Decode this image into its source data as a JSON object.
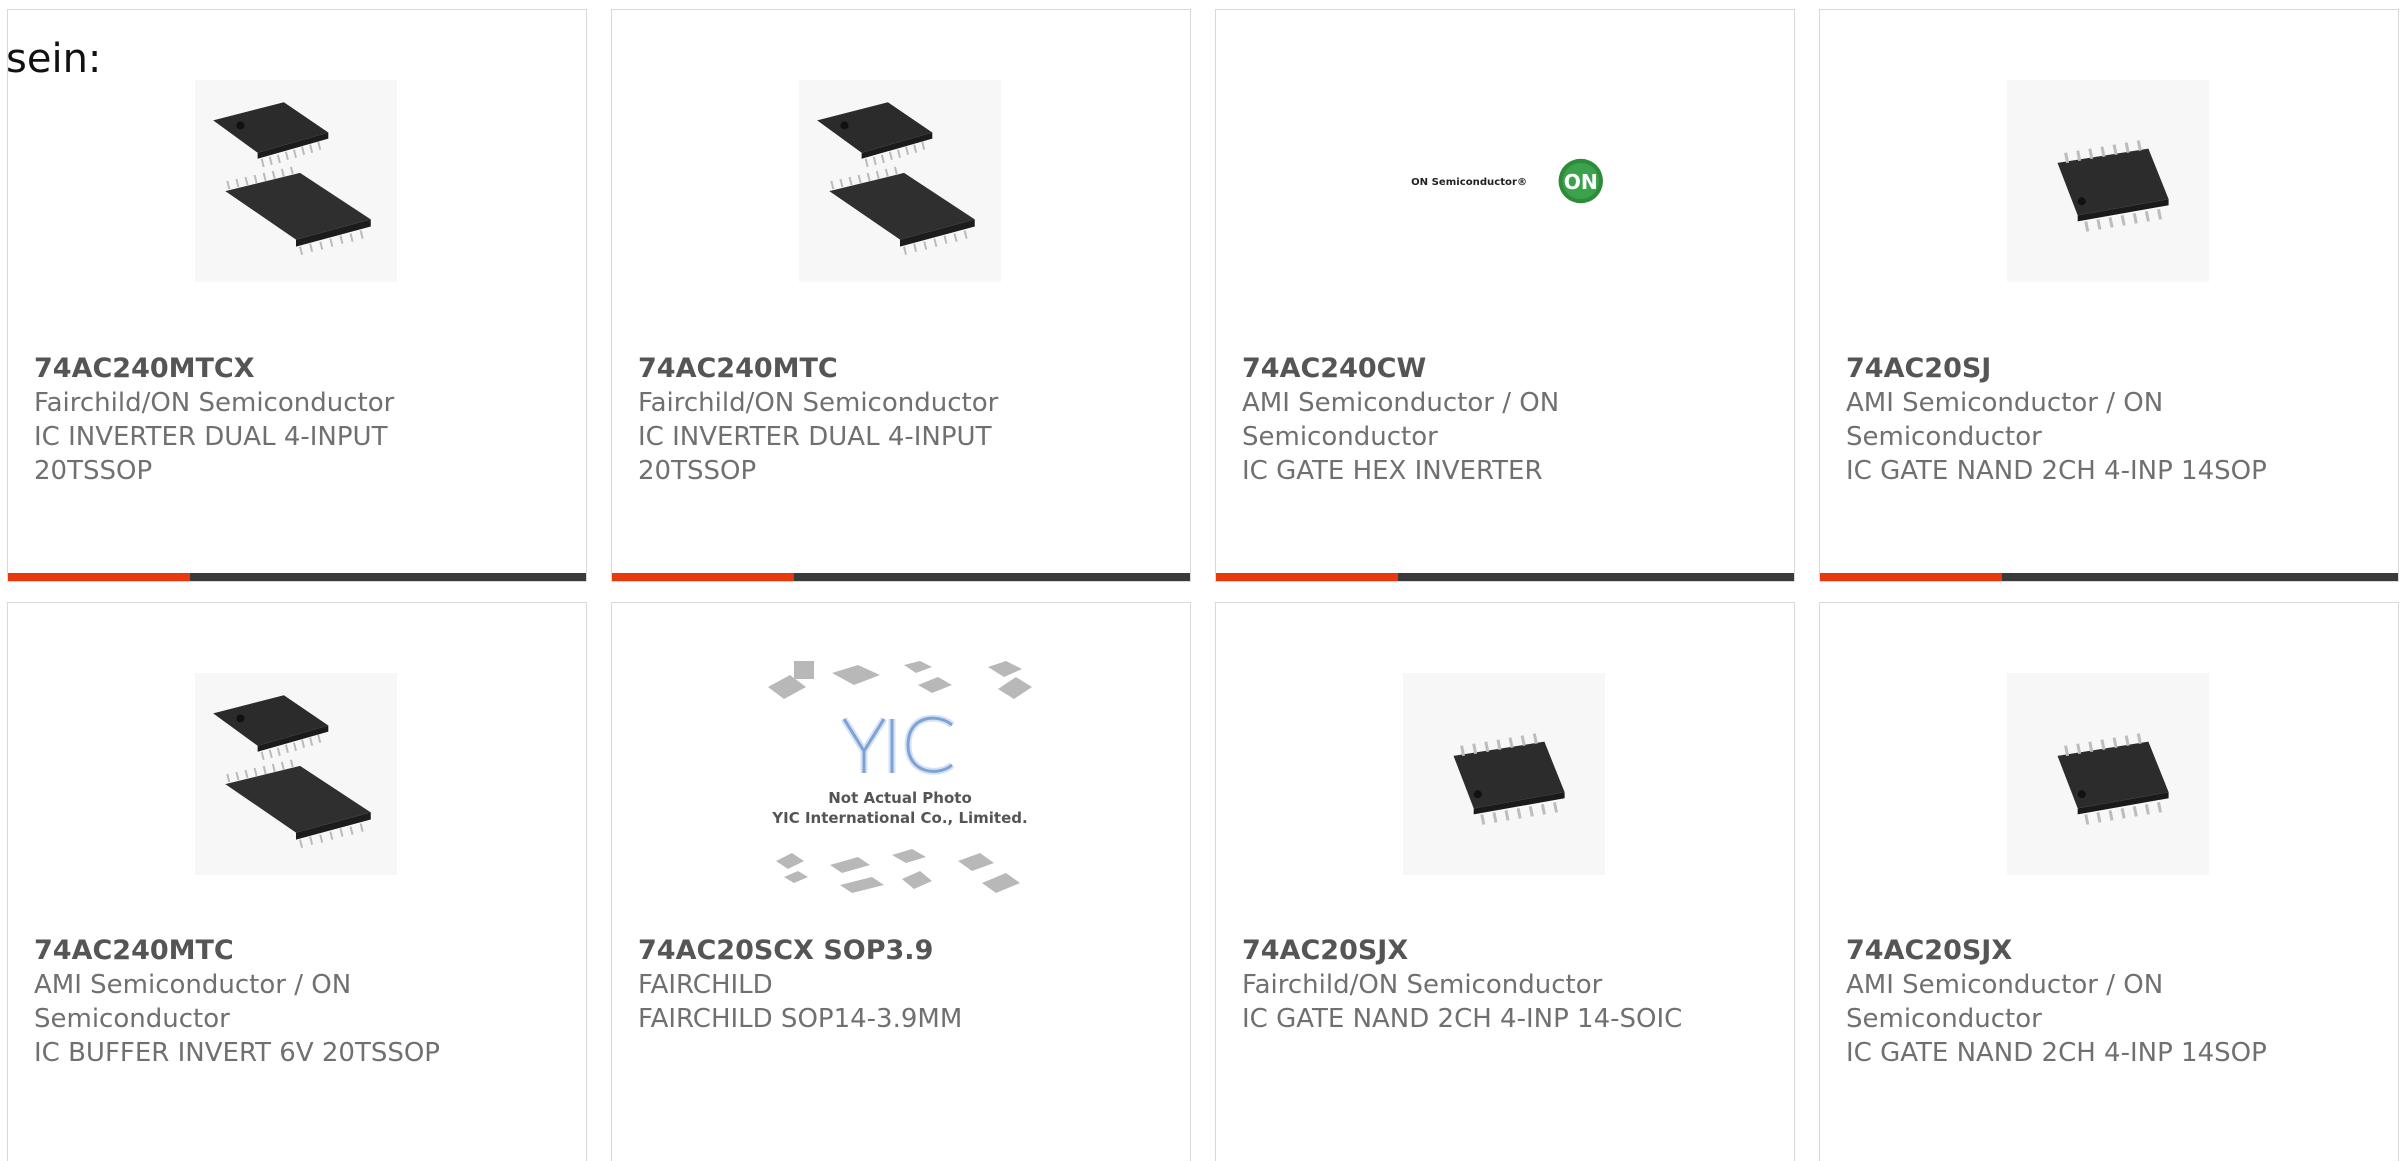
{
  "lead_text": "sein:",
  "colors": {
    "accent": "#e8380d",
    "bar": "#3a3a3a",
    "border": "#d9d9d9",
    "text": "#707070",
    "part_number": "#555555"
  },
  "products": [
    {
      "part_number": "74AC240MTCX",
      "manufacturer": "Fairchild/ON Semiconductor",
      "description": "IC INVERTER DUAL 4-INPUT 20TSSOP",
      "image": "tssop-chip-pair"
    },
    {
      "part_number": "74AC240MTC",
      "manufacturer": "Fairchild/ON Semiconductor",
      "description": "IC INVERTER DUAL 4-INPUT 20TSSOP",
      "image": "tssop-chip-pair"
    },
    {
      "part_number": "74AC240CW",
      "manufacturer": "AMI Semiconductor / ON Semiconductor",
      "description": "IC GATE HEX INVERTER",
      "image": "on-semiconductor-logo",
      "logo_text": "ON Semiconductor®",
      "logo_badge": "ON"
    },
    {
      "part_number": "74AC20SJ",
      "manufacturer": "AMI Semiconductor / ON Semiconductor",
      "description": "IC GATE NAND 2CH 4-INP 14SOP",
      "image": "sop-chip"
    },
    {
      "part_number": "74AC240MTC",
      "manufacturer": "AMI Semiconductor / ON Semiconductor",
      "description": "IC BUFFER INVERT 6V 20TSSOP",
      "image": "tssop-chip-pair"
    },
    {
      "part_number": "74AC20SCX SOP3.9",
      "manufacturer": "FAIRCHILD",
      "description": "FAIRCHILD SOP14-3.9MM",
      "image": "yic-placeholder",
      "placeholder_lines": [
        "YIC",
        "Not Actual Photo",
        "YIC International Co., Limited."
      ]
    },
    {
      "part_number": "74AC20SJX",
      "manufacturer": "Fairchild/ON Semiconductor",
      "description": "IC GATE NAND 2CH 4-INP 14-SOIC",
      "image": "sop-chip"
    },
    {
      "part_number": "74AC20SJX",
      "manufacturer": "AMI Semiconductor / ON Semiconductor",
      "description": "IC GATE NAND 2CH 4-INP 14SOP",
      "image": "sop-chip"
    }
  ]
}
